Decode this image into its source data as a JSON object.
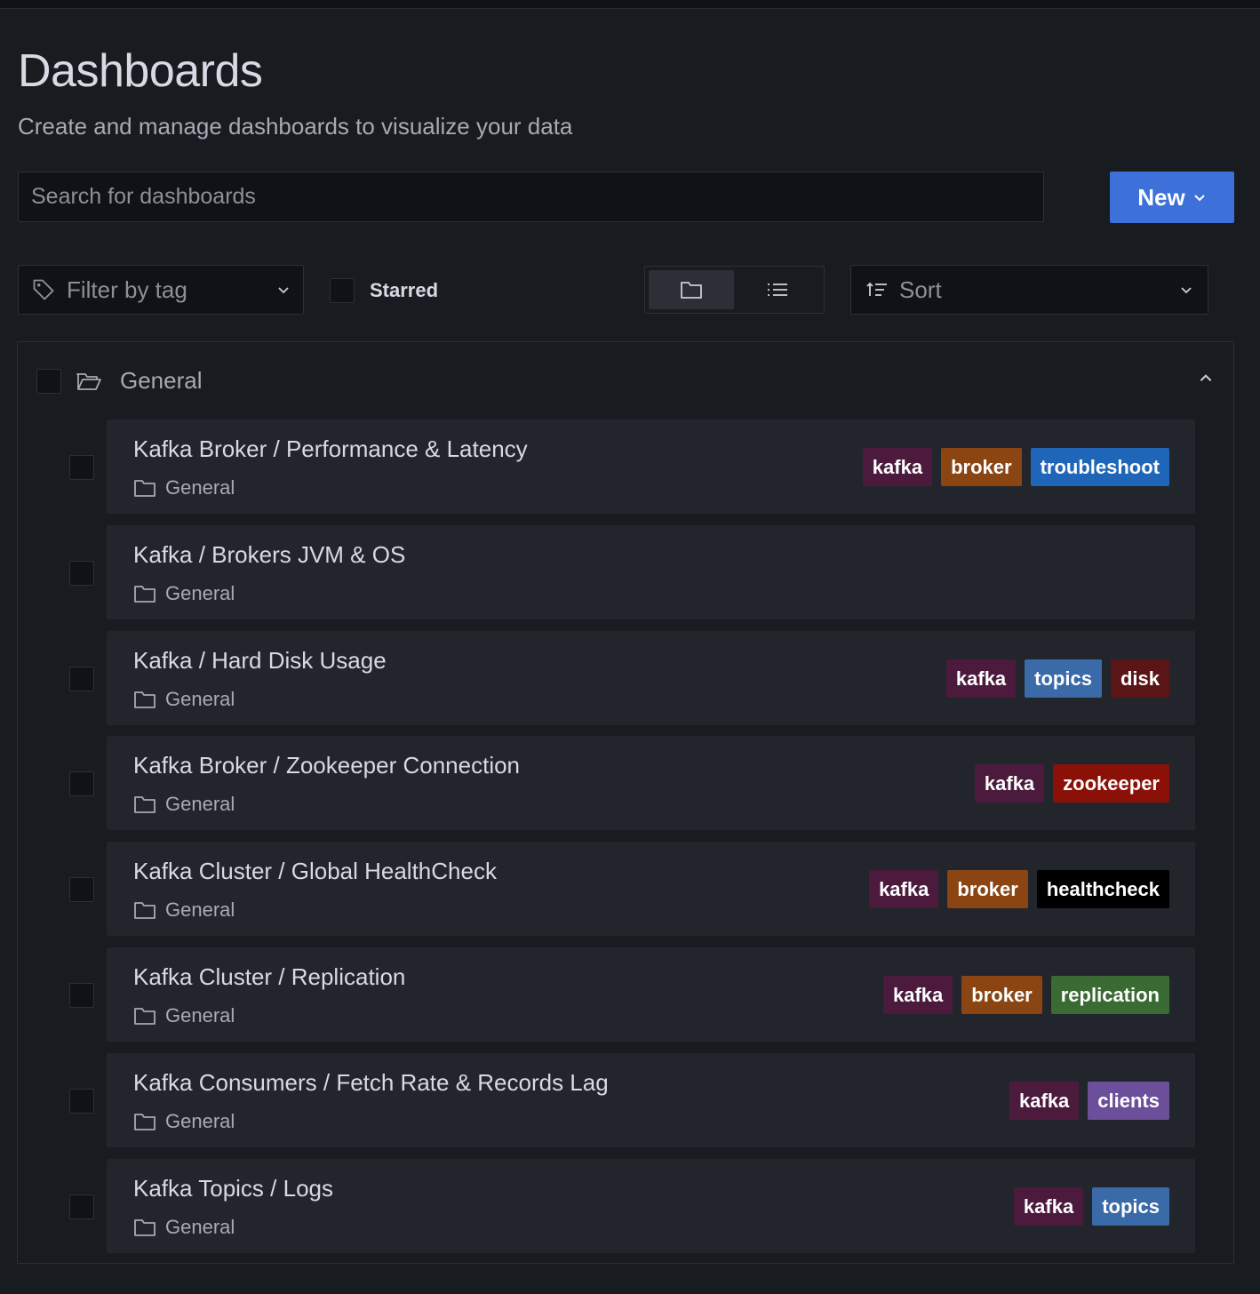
{
  "header": {
    "title": "Dashboards",
    "subtitle": "Create and manage dashboards to visualize your data"
  },
  "search": {
    "placeholder": "Search for dashboards",
    "value": ""
  },
  "new_button": {
    "label": "New",
    "icon": "chevron-down-icon",
    "color": "#3d71d9"
  },
  "filters": {
    "tag_filter": {
      "label": "Filter by tag",
      "icon": "tag-icon"
    },
    "starred": {
      "label": "Starred",
      "checked": false
    },
    "view_mode": {
      "options": [
        "folder-view",
        "list-view"
      ],
      "active": "folder-view"
    },
    "sort": {
      "label": "Sort",
      "icon": "sort-icon"
    }
  },
  "folder": {
    "name": "General",
    "expanded": true,
    "items": [
      {
        "title": "Kafka Broker / Performance & Latency",
        "folder": "General",
        "tags": [
          {
            "label": "kafka",
            "color": "#4b1a3d"
          },
          {
            "label": "broker",
            "color": "#8a4513"
          },
          {
            "label": "troubleshoot",
            "color": "#1f66b8"
          }
        ]
      },
      {
        "title": "Kafka / Brokers JVM & OS",
        "folder": "General",
        "tags": []
      },
      {
        "title": "Kafka / Hard Disk Usage",
        "folder": "General",
        "tags": [
          {
            "label": "kafka",
            "color": "#4b1a3d"
          },
          {
            "label": "topics",
            "color": "#3b6aa8"
          },
          {
            "label": "disk",
            "color": "#5a1616"
          }
        ]
      },
      {
        "title": "Kafka Broker / Zookeeper Connection",
        "folder": "General",
        "tags": [
          {
            "label": "kafka",
            "color": "#4b1a3d"
          },
          {
            "label": "zookeeper",
            "color": "#8b1108"
          }
        ]
      },
      {
        "title": "Kafka Cluster / Global HealthCheck",
        "folder": "General",
        "tags": [
          {
            "label": "kafka",
            "color": "#4b1a3d"
          },
          {
            "label": "broker",
            "color": "#8a4513"
          },
          {
            "label": "healthcheck",
            "color": "#000000"
          }
        ]
      },
      {
        "title": "Kafka Cluster / Replication",
        "folder": "General",
        "tags": [
          {
            "label": "kafka",
            "color": "#4b1a3d"
          },
          {
            "label": "broker",
            "color": "#8a4513"
          },
          {
            "label": "replication",
            "color": "#3a6b33"
          }
        ]
      },
      {
        "title": "Kafka Consumers / Fetch Rate & Records Lag",
        "folder": "General",
        "tags": [
          {
            "label": "kafka",
            "color": "#4b1a3d"
          },
          {
            "label": "clients",
            "color": "#6b4f9a"
          }
        ]
      },
      {
        "title": "Kafka Topics / Logs",
        "folder": "General",
        "tags": [
          {
            "label": "kafka",
            "color": "#4b1a3d"
          },
          {
            "label": "topics",
            "color": "#3b6aa8"
          }
        ]
      }
    ]
  }
}
